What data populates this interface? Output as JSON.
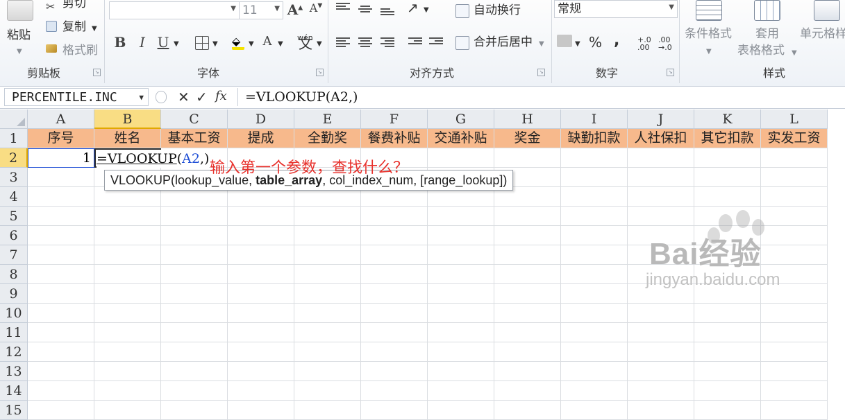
{
  "ribbon": {
    "clipboard": {
      "paste_label": "粘贴",
      "cut_label": "剪切",
      "copy_label": "复制",
      "format_painter_label": "格式刷",
      "group_label": "剪贴板"
    },
    "font": {
      "font_size": "11",
      "bold": "B",
      "italic": "I",
      "underline": "U",
      "font_color": "A",
      "phonetic": "wén",
      "group_label": "字体"
    },
    "alignment": {
      "wrap_text_label": "自动换行",
      "merge_center_label": "合并后居中",
      "group_label": "对齐方式"
    },
    "number": {
      "format_value": "常规",
      "percent": "%",
      "comma": ",",
      "inc_decimal": "+.0 .00",
      "dec_decimal": ".00 →.0",
      "group_label": "数字"
    },
    "styles": {
      "conditional_format_label": "条件格式",
      "table_format_label_1": "套用",
      "table_format_label_2": "表格格式",
      "cell_styles_label": "单元格样",
      "group_label": "样式"
    }
  },
  "formula_bar": {
    "name_box": "PERCENTILE.INC",
    "cancel": "✕",
    "enter": "✓",
    "fx": "fx",
    "formula": "=VLOOKUP(A2,)"
  },
  "sheet": {
    "columns": [
      "A",
      "B",
      "C",
      "D",
      "E",
      "F",
      "G",
      "H",
      "I",
      "J",
      "K",
      "L"
    ],
    "rows": [
      "1",
      "2",
      "3",
      "4",
      "5",
      "6",
      "7",
      "8",
      "9",
      "10",
      "11",
      "12",
      "13",
      "14",
      "15"
    ],
    "header_row": [
      "序号",
      "姓名",
      "基本工资",
      "提成",
      "全勤奖",
      "餐费补贴",
      "交通补贴",
      "奖金",
      "缺勤扣款",
      "人社保扣",
      "其它扣款",
      "实发工资"
    ],
    "a2_value": "1",
    "edit": {
      "func": "=VLOOKUP",
      "open": "(",
      "ref": "A2",
      "rest": ",)"
    },
    "tooltip": {
      "prefix": "VLOOKUP(lookup_value, ",
      "current": "table_array",
      "suffix": ", col_index_num, [range_lookup])"
    },
    "annotation": "输入第一个参数，查找什么？"
  },
  "watermark": {
    "brand": "Bai经验",
    "url": "jingyan.baidu.com"
  },
  "colors": {
    "header_fill": "#f7b98c",
    "selection": "#f9dd84",
    "annotation": "#e8322d",
    "ref_blue": "#1f4fd6"
  }
}
